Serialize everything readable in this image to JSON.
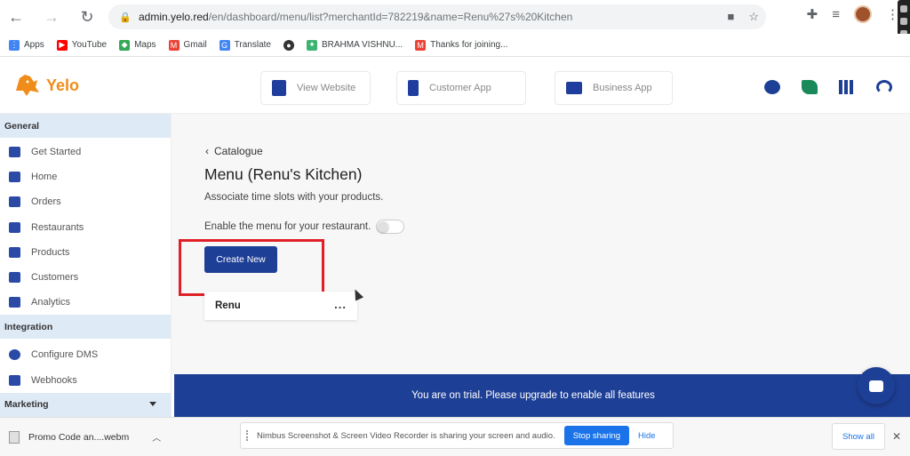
{
  "browser": {
    "url_host": "admin.yelo.red",
    "url_path": "/en/dashboard/menu/list?merchantId=782219&name=Renu%27s%20Kitchen",
    "bookmarks": [
      {
        "label": "Apps",
        "icon": "apps-grid-icon",
        "color": "#4285f4"
      },
      {
        "label": "YouTube",
        "icon": "youtube-icon",
        "color": "#ff0000"
      },
      {
        "label": "Maps",
        "icon": "maps-icon",
        "color": "#34a853"
      },
      {
        "label": "Gmail",
        "icon": "gmail-icon",
        "color": "#ea4335"
      },
      {
        "label": "Translate",
        "icon": "translate-icon",
        "color": "#4285f4"
      },
      {
        "label": "",
        "icon": "github-icon",
        "color": "#333333"
      },
      {
        "label": "BRAHMA VISHNU...",
        "icon": "site-icon",
        "color": "#3cb371"
      },
      {
        "label": "Thanks for joining...",
        "icon": "gmail-icon",
        "color": "#ea4335"
      }
    ]
  },
  "header": {
    "brand": "Yelo",
    "tabs": [
      {
        "label": "View Website"
      },
      {
        "label": "Customer App"
      },
      {
        "label": "Business App"
      }
    ],
    "icons": [
      "chat-icon",
      "leaf-icon",
      "grid-icon",
      "headset-icon"
    ]
  },
  "sidebar": {
    "sections": {
      "general": "General",
      "integration": "Integration",
      "marketing": "Marketing"
    },
    "general_items": [
      {
        "label": "Get Started"
      },
      {
        "label": "Home"
      },
      {
        "label": "Orders"
      },
      {
        "label": "Restaurants"
      },
      {
        "label": "Products"
      },
      {
        "label": "Customers"
      },
      {
        "label": "Analytics"
      }
    ],
    "integration_items": [
      {
        "label": "Configure DMS"
      },
      {
        "label": "Webhooks"
      }
    ]
  },
  "main": {
    "breadcrumb": "Catalogue",
    "title": "Menu (Renu's Kitchen)",
    "subtitle": "Associate time slots with your products.",
    "toggle_label": "Enable the menu for your restaurant.",
    "toggle_on": false,
    "create_button": "Create New",
    "menu_items": [
      {
        "name": "Renu",
        "more": "..."
      }
    ]
  },
  "trial_banner": "You are on trial. Please upgrade to enable all features",
  "downloads": {
    "file_name": "Promo Code an....webm",
    "share_text": "Nimbus Screenshot & Screen Video Recorder is sharing your screen and audio.",
    "stop_sharing": "Stop sharing",
    "hide": "Hide",
    "show_all": "Show all",
    "close": "✕"
  },
  "colors": {
    "brand_blue": "#1e3f96",
    "brand_orange": "#f08c1a",
    "highlight_red": "#e01f26",
    "sidebar_section_bg": "#dfeaf7"
  }
}
